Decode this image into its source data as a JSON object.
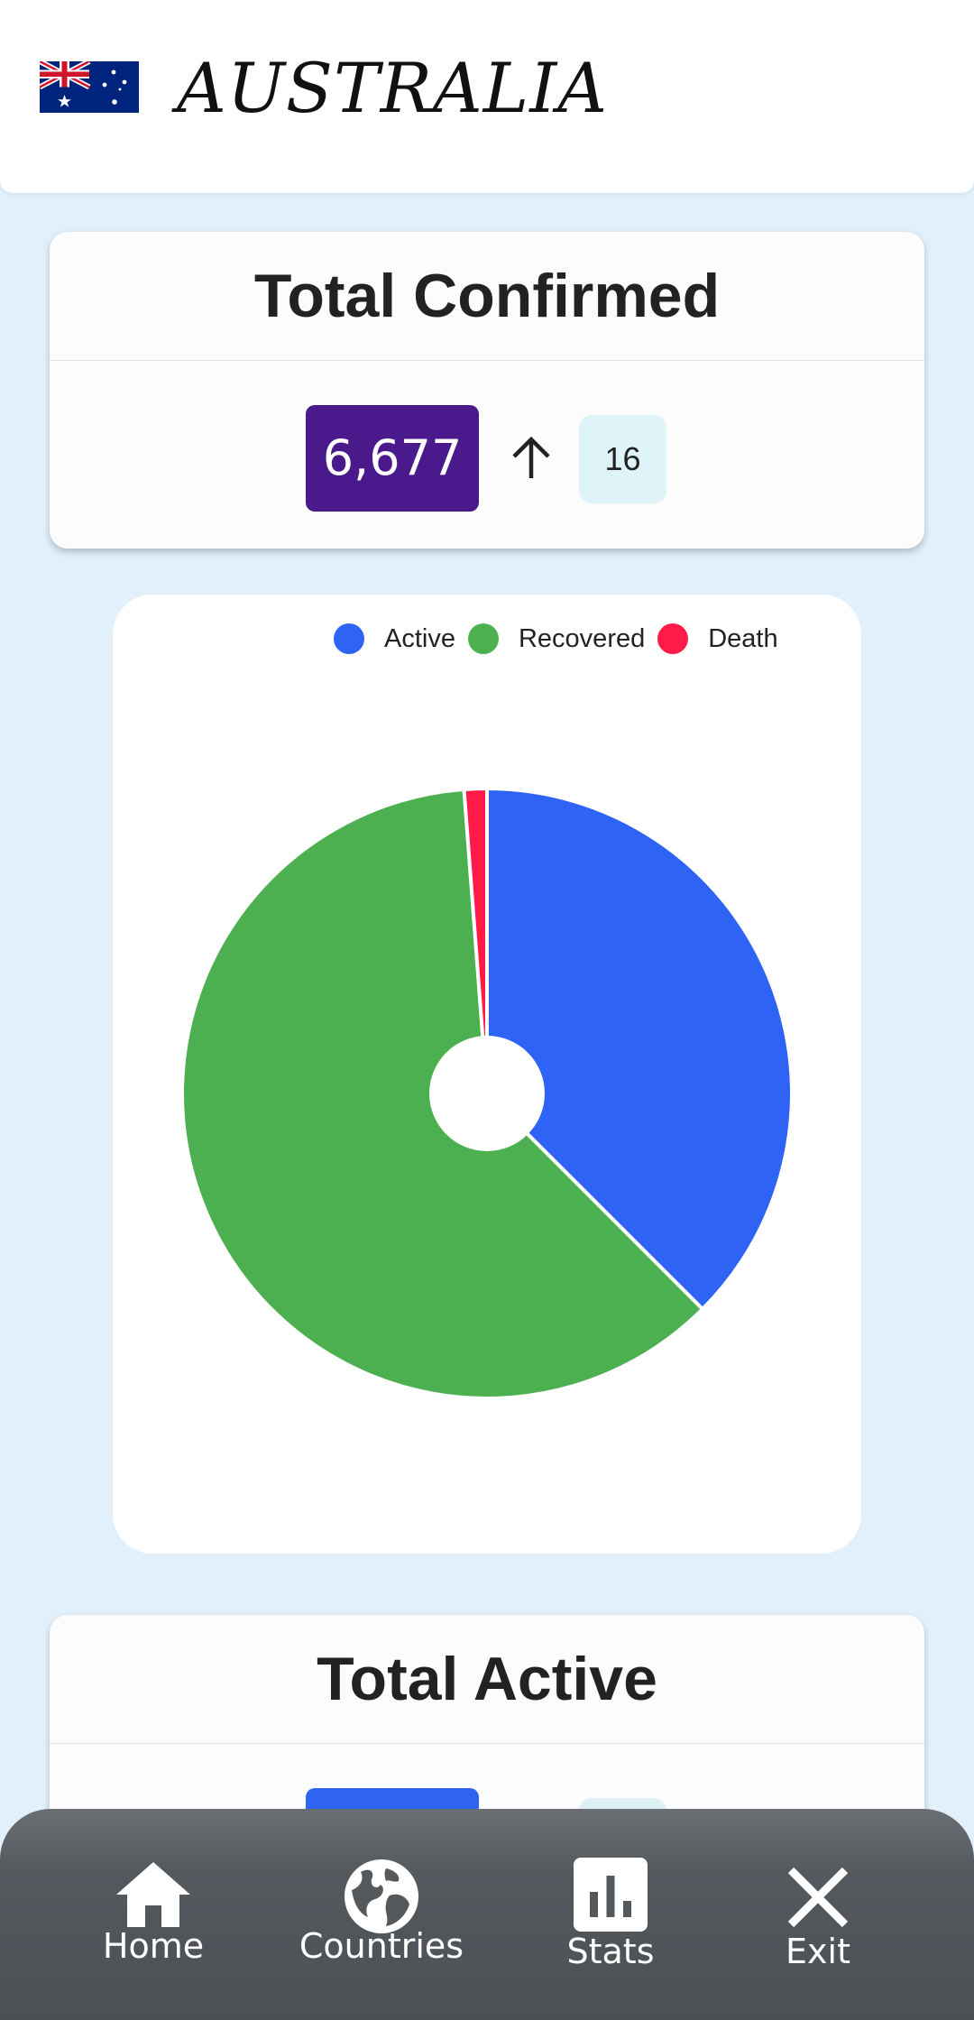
{
  "header": {
    "country": "AUSTRALIA",
    "flag": "australia-flag"
  },
  "confirmed": {
    "title": "Total Confirmed",
    "count": "6,677",
    "delta": "16",
    "badge_color": "#4a1a8c"
  },
  "active": {
    "title": "Total Active",
    "badge_color": "#2f64f2"
  },
  "legend": [
    {
      "label": "Active",
      "color": "#2e63f6"
    },
    {
      "label": "Recovered",
      "color": "#4caf50"
    },
    {
      "label": "Death",
      "color": "#ff1a47"
    }
  ],
  "chart_data": {
    "type": "pie",
    "categories": [
      "Active",
      "Recovered",
      "Death"
    ],
    "values": [
      37.5,
      61.3,
      1.2
    ],
    "unit": "percent",
    "colors": [
      "#2e63f6",
      "#4caf50",
      "#ff1a47"
    ],
    "legend": "top"
  },
  "nav": {
    "home": "Home",
    "countries": "Countries",
    "stats": "Stats",
    "exit": "Exit"
  },
  "icons": {
    "home": "home-icon",
    "countries": "globe-icon",
    "stats": "bar-chart-icon",
    "exit": "close-icon",
    "trend": "arrow-up-icon"
  }
}
